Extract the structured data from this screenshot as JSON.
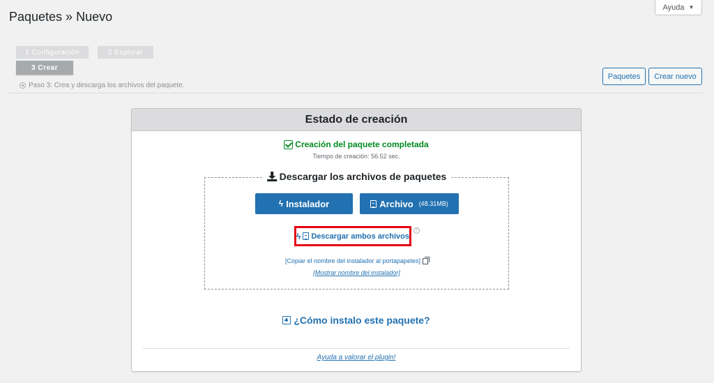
{
  "header": {
    "title": "Paquetes » Nuevo",
    "help_label": "Ayuda",
    "help_caret": "▼"
  },
  "steps": {
    "items": [
      {
        "label": "1 Configuración",
        "state": "done"
      },
      {
        "label": "2 Explorar",
        "state": "done"
      },
      {
        "label": "3 Crear",
        "state": "active"
      }
    ],
    "description": "Paso 3: Crea y descarga los archivos del paquete."
  },
  "toolbar": {
    "packages_label": "Paquetes",
    "new_label": "Crear nuevo"
  },
  "panel": {
    "title": "Estado de creación",
    "status": "Creación del paquete completada",
    "time_label": "Tiempo de creación:",
    "time_value": "56.52 sec.",
    "download": {
      "title": "Descargar los archivos de paquetes",
      "installer_label": "Instalador",
      "archive_label": "Archivo",
      "archive_size": "(48.31MB)",
      "both_label": "Descargar ambos archivos",
      "copy_label": "[Copiar el nombre del instalador al portapapeles]",
      "show_label": "[Mostrar nombre del instalador]"
    },
    "how_label": "¿Cómo instalo este paquete?",
    "rate_label": "Ayuda a valorar el plugin!"
  },
  "colors": {
    "accent": "#2271b1",
    "success": "#008a20",
    "highlight": "#e40014"
  }
}
